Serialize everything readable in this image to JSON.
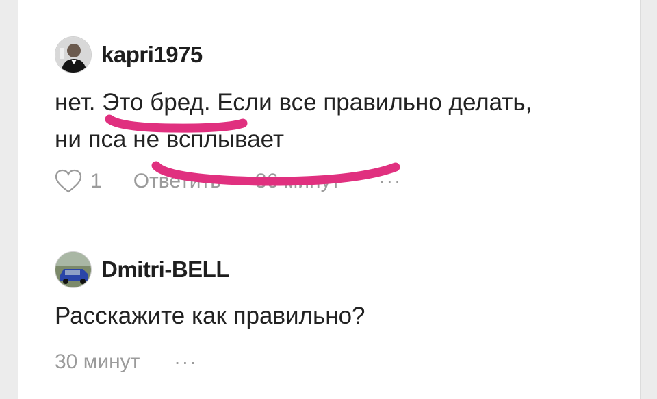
{
  "comments": [
    {
      "username": "kapri1975",
      "avatar_icon": "avatar-photo-man-raising-glass",
      "text_lines": [
        "нет. Это бред. Если все правильно делать,",
        "ни пса не всплывает"
      ],
      "likes": "1",
      "reply_label": "Ответить",
      "time": "36 минут",
      "more": "···"
    },
    {
      "username": "Dmitri-BELL",
      "avatar_icon": "avatar-photo-blue-car",
      "text_lines": [
        "Расскажите как правильно?"
      ],
      "time": "30 минут",
      "more": "···"
    }
  ],
  "annotation_color": "#e0307f"
}
